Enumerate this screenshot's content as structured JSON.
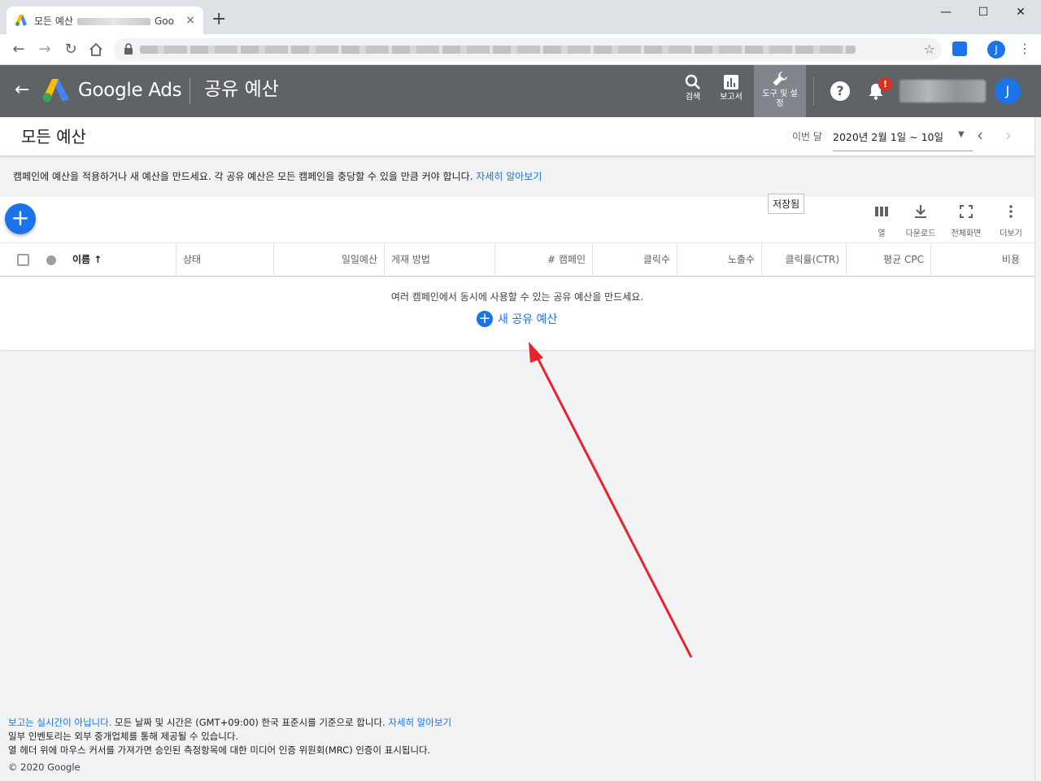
{
  "browser": {
    "tab_title": "모든 예산",
    "tab_title_suffix": "Goo",
    "tab_close": "×",
    "new_tab": "+",
    "window_minimize": "—",
    "window_maximize": "☐",
    "window_close": "✕",
    "back": "←",
    "forward": "→",
    "reload": "↻",
    "star": "☆",
    "profile_initial": "J",
    "menu": "⋮"
  },
  "ads_header": {
    "back": "←",
    "product_name": "Google Ads",
    "page_name": "공유 예산",
    "tools": [
      {
        "label": "검색"
      },
      {
        "label": "보고서"
      },
      {
        "label_line1": "도구 및 설",
        "label_line2": "정"
      }
    ],
    "help": "?",
    "notification_badge": "!",
    "avatar_initial": "J"
  },
  "title_row": {
    "title": "모든 예산",
    "date_range_label": "이번 달",
    "date_range_value": "2020년 2월 1일 ~ 10일",
    "dropdown": "▼",
    "prev": "‹",
    "next": "›"
  },
  "info_banner": {
    "text": "캠페인에 예산을 적용하거나 새 예산을 만드세요. 각 공유 예산은 모든 캠페인을 충당할 수 있을 만큼 커야 합니다.",
    "link": "자세히 알아보기"
  },
  "table": {
    "fab": "+",
    "tooltip": "저장됨",
    "tools": [
      {
        "label": "열"
      },
      {
        "label": "다운로드"
      },
      {
        "label": "전체화면"
      },
      {
        "label": "더보기"
      }
    ],
    "columns": [
      "이름",
      "상태",
      "일일예산",
      "게재 방법",
      "# 캠페인",
      "클릭수",
      "노출수",
      "클릭률(CTR)",
      "평균 CPC",
      "비용"
    ],
    "sort_arrow": "↑",
    "empty_message": "여러 캠페인에서 동시에 사용할 수 있는 공유 예산을 만드세요.",
    "new_budget_label": "새 공유 예산",
    "new_budget_plus": "+"
  },
  "footer": {
    "line1_link": "보고는 실시간이 아닙니다.",
    "line1_text": "모든 날짜 및 시간은 (GMT+09:00) 한국 표준시를 기준으로 합니다.",
    "line1_link2": "자세히 알아보기",
    "line2": "일부 인벤토리는 외부 중개업체를 통해 제공될 수 있습니다.",
    "line3": "열 헤더 위에 마우스 커서를 가져가면 승인된 측정항목에 대한 미디어 인증 위원회(MRC) 인증이 표시됩니다.",
    "copyright": "© 2020 Google"
  },
  "colors": {
    "accent": "#1a73e8",
    "header_bg": "#5f6368",
    "annotation_arrow": "#e8232b",
    "alert": "#d93025"
  }
}
